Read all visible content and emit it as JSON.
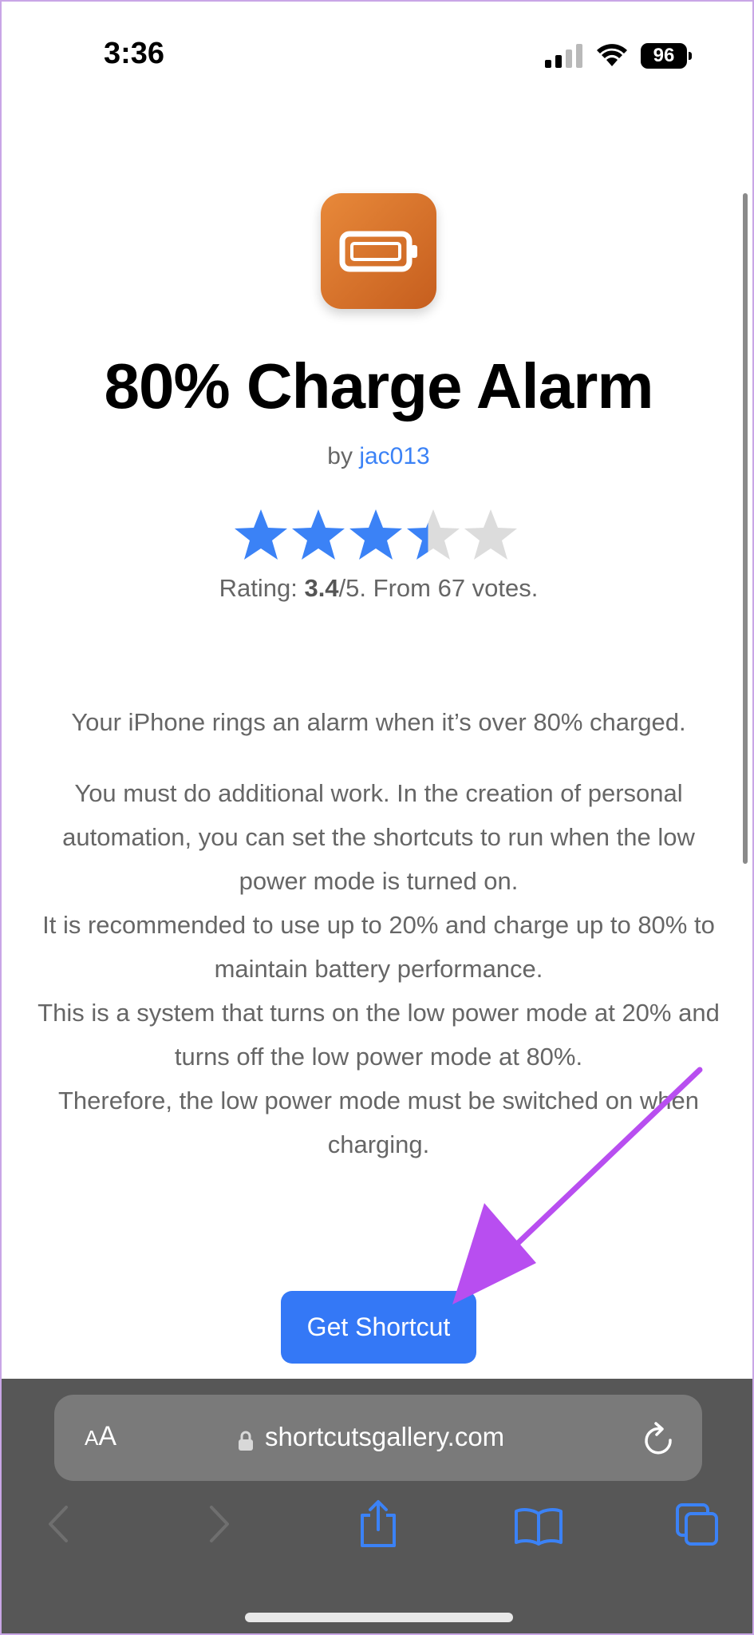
{
  "status": {
    "time": "3:36",
    "battery": "96"
  },
  "shortcut": {
    "title": "80% Charge Alarm",
    "author_prefix": "by",
    "author": "jac013",
    "rating_prefix": "Rating:",
    "rating_value": "3.4",
    "rating_suffix": "/5. From 67 votes.",
    "rating_fraction": 0.68,
    "summary": "Your iPhone rings an alarm when it’s over 80% charged.",
    "body_lines": [
      "You must do additional work. In the creation of personal automation, you can set the shortcuts to run when the low power mode is turned on.",
      "It is recommended to use up to 20% and charge up to 80% to maintain battery performance.",
      "This is a system that turns on the low power mode at 20% and turns off the low power mode at 80%.",
      "Therefore, the low power mode must be switched on when charging."
    ],
    "button_label": "Get Shortcut"
  },
  "browser": {
    "text_size_label_small": "A",
    "text_size_label_large": "A",
    "domain": "shortcutsgallery.com"
  },
  "colors": {
    "accent": "#3478f6",
    "icon_orange": "#e07a2f",
    "annotation_arrow": "#b84ef0",
    "toolbar": "#575757"
  },
  "icons": {
    "app": "battery-icon",
    "toolbar": [
      "back-icon",
      "forward-icon",
      "share-icon",
      "bookmarks-icon",
      "tabs-icon"
    ]
  }
}
